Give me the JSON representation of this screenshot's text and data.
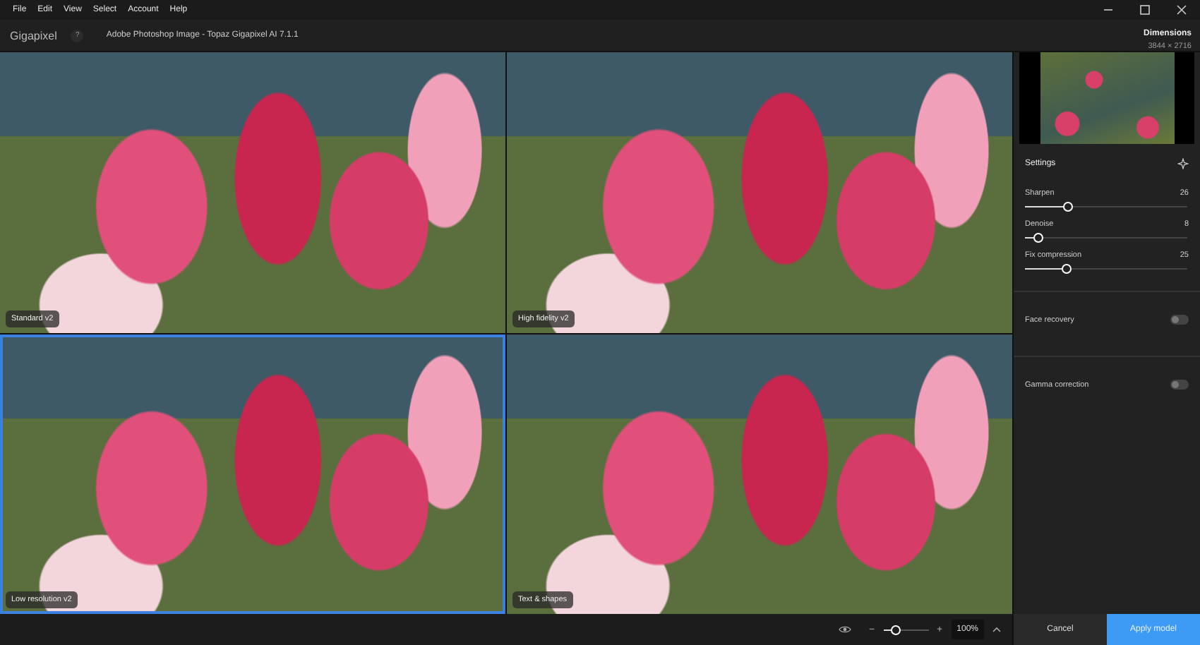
{
  "menu": [
    "File",
    "Edit",
    "View",
    "Select",
    "Account",
    "Help"
  ],
  "app": {
    "name": "Gigapixel",
    "help": "?",
    "document_title": "Adobe Photoshop Image - Topaz Gigapixel AI 7.1.1"
  },
  "dimensions": {
    "label": "Dimensions",
    "value": "3844 × 2716"
  },
  "previews": [
    {
      "label": "Standard v2",
      "selected": false
    },
    {
      "label": "High fidelity v2",
      "selected": false
    },
    {
      "label": "Low resolution v2",
      "selected": true
    },
    {
      "label": "Text & shapes",
      "selected": false
    }
  ],
  "settings": {
    "title": "Settings",
    "sliders": [
      {
        "name": "Sharpen",
        "reading": "26",
        "level": 0.26
      },
      {
        "name": "Denoise",
        "reading": "8",
        "level": 0.08
      },
      {
        "name": "Fix compression",
        "reading": "25",
        "level": 0.25
      }
    ],
    "toggles": [
      {
        "name": "Face recovery",
        "on": false
      },
      {
        "name": "Gamma correction",
        "on": false
      }
    ]
  },
  "zoom": {
    "minus": "−",
    "plus": "+",
    "level": 0.25,
    "reading": "100%"
  },
  "buttons": [
    {
      "label": "Cancel",
      "kind": "secondary"
    },
    {
      "label": "Apply model",
      "kind": "primary"
    }
  ]
}
